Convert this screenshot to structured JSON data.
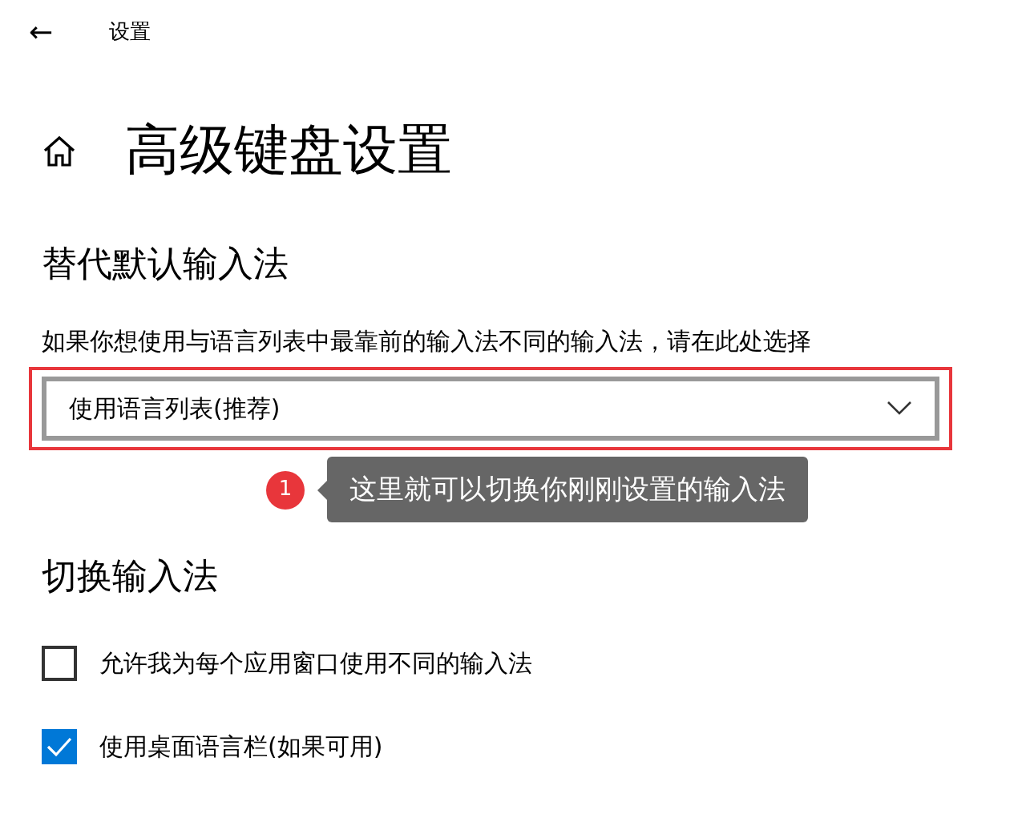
{
  "window": {
    "title": "设置",
    "back": "←"
  },
  "page": {
    "title": "高级键盘设置"
  },
  "sections": [
    {
      "heading": "替代默认输入法",
      "description": "如果你想使用与语言列表中最靠前的输入法不同的输入法，请在此处选择",
      "dropdown": {
        "value": "使用语言列表(推荐)",
        "highlighted": true
      },
      "annotation": {
        "number": "1",
        "text": "这里就可以切换你刚刚设置的输入法"
      }
    },
    {
      "heading": "切换输入法",
      "checkboxes": [
        {
          "label": "允许我为每个应用窗口使用不同的输入法",
          "checked": false
        },
        {
          "label": "使用桌面语言栏(如果可用)",
          "checked": true
        }
      ]
    }
  ]
}
